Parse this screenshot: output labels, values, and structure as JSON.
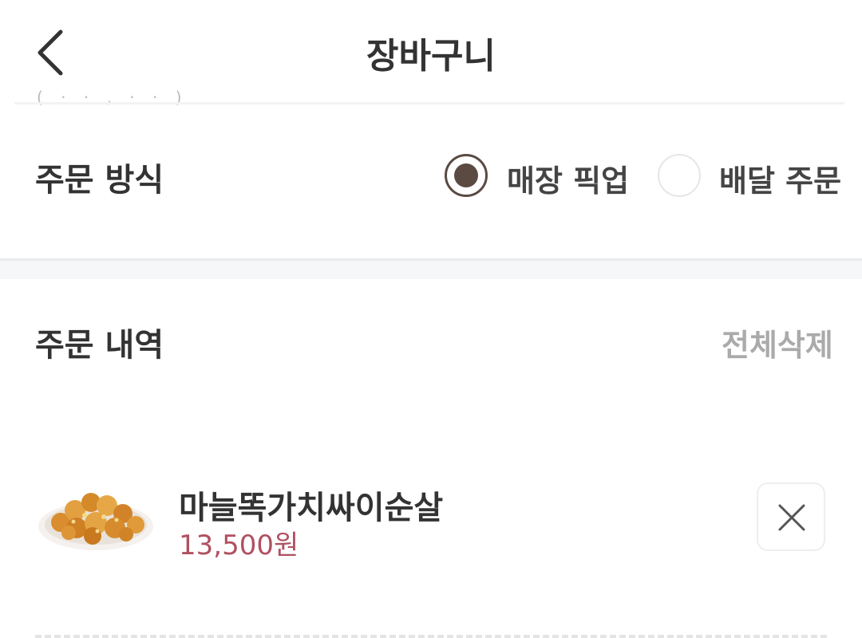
{
  "header": {
    "title": "장바구니",
    "back_icon": "chevron-left-icon"
  },
  "scroll_residue": "( · · , · · )",
  "order_method": {
    "title": "주문 방식",
    "options": [
      {
        "label": "매장 픽업",
        "selected": true
      },
      {
        "label": "배달 주문",
        "selected": false
      }
    ],
    "accent_color": "#5a4a42"
  },
  "order_history": {
    "title": "주문 내역",
    "delete_all_label": "전체삭제"
  },
  "cart_items": [
    {
      "name": "마늘똑가치싸이순살",
      "price": "13,500원",
      "image_icon": "fried-chicken-image",
      "remove_icon": "close-icon"
    }
  ],
  "colors": {
    "price": "#b05060",
    "muted": "#aaaaaa",
    "text": "#333333"
  }
}
